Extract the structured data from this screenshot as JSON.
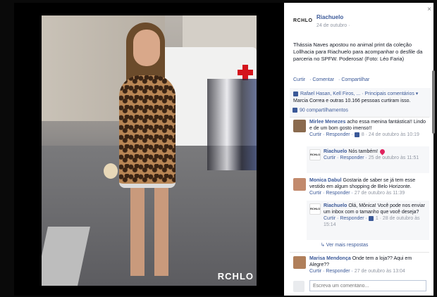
{
  "photo": {
    "watermark": "RCHLO"
  },
  "header": {
    "page_name": "Riachuelo",
    "date": "24 de outubro ·",
    "logo_text": "RCHLO",
    "close_label": "×"
  },
  "post": {
    "text": "Thássia Naves apostou no animal print da coleção Lollhacia para Riachuelo para acompanhar o desfile da parceria no SPFW. Poderosa! (Foto: Léo Faria)",
    "actions": [
      "Curtir",
      "· Comentar",
      "· Compartilhar"
    ]
  },
  "likes": {
    "line1": "Rafael Hasan, Kell Firos, ... · Principais comentários ▾",
    "line2": "Marcia Correa e outras 10.166 pessoas curtiram isso.",
    "shares": "90 compartilhamentos"
  },
  "comments": [
    {
      "name": "Mirlee Menezes",
      "text": "acho essa menina fantástica!! Lindo e de um bom gosto imenso!!",
      "meta_actions": "Curtir · Responder ·",
      "meta_time": "8 · 24 de outubro às 10:19",
      "avatar_color": "#8a6a4e"
    },
    {
      "name": "Riachuelo",
      "text": "Nós também!",
      "meta_actions": "Curtir · Responder ·",
      "meta_time": "25 de outubro às 11:51",
      "reply": true
    },
    {
      "name": "Monica Dabul",
      "text": "Gostaria de saber se já tem esse vestido em algum shopping de Belo Horizonte.",
      "meta_actions": "Curtir · Responder ·",
      "meta_time": "27 de outubro às 11:39",
      "avatar_color": "#c28a6d"
    },
    {
      "name": "Riachuelo",
      "text": "Olá, Mônica! Você pode nos enviar um inbox com o tamanho que você deseja?",
      "meta_actions": "Curtir · Responder ·",
      "meta_time": "1 · 28 de outubro às 15:14",
      "reply": true
    },
    {
      "name": "Marisa Mendonça",
      "text": "Onde tem a loja?? Aqui em Alegre??",
      "meta_actions": "Curtir · Responder ·",
      "meta_time": "27 de outubro às 13:04",
      "avatar_color": "#b07f5a"
    }
  ],
  "more_replies": "↳ Ver mais respostas",
  "compose": {
    "placeholder": "Escreva um comentário..."
  }
}
